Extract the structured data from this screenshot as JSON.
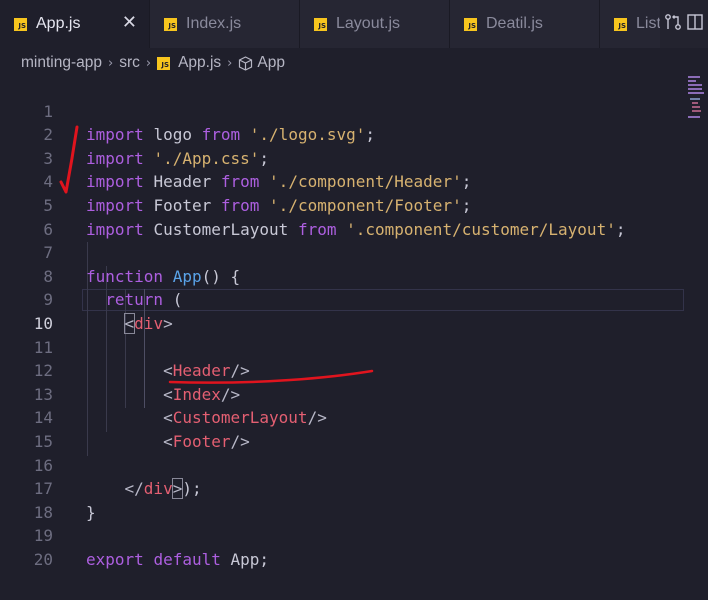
{
  "tabs": [
    {
      "label": "App.js",
      "active": true
    },
    {
      "label": "Index.js",
      "active": false
    },
    {
      "label": "Layout.js",
      "active": false
    },
    {
      "label": "Deatil.js",
      "active": false
    },
    {
      "label": "List",
      "active": false
    }
  ],
  "tab_close_symbol": "✕",
  "breadcrumb": {
    "parts": [
      "minting-app",
      "src",
      "App.js",
      "App"
    ],
    "separator": "›"
  },
  "code_lines": [
    {
      "n": "1"
    },
    {
      "n": "2"
    },
    {
      "n": "3"
    },
    {
      "n": "4"
    },
    {
      "n": "5"
    },
    {
      "n": "6"
    },
    {
      "n": "7"
    },
    {
      "n": "8"
    },
    {
      "n": "9"
    },
    {
      "n": "10"
    },
    {
      "n": "11"
    },
    {
      "n": "12"
    },
    {
      "n": "13"
    },
    {
      "n": "14"
    },
    {
      "n": "15"
    },
    {
      "n": "16"
    },
    {
      "n": "17"
    },
    {
      "n": "18"
    },
    {
      "n": "19"
    },
    {
      "n": "20"
    }
  ],
  "tokens": {
    "import": "import",
    "from": "from",
    "logo": "logo",
    "logo_path": "'./logo.svg'",
    "css_path": "'./App.css'",
    "header": "Header",
    "header_path": "'./component/Header'",
    "footer": "Footer",
    "footer_path": "'./component/Footer'",
    "customer_layout": "CustomerLayout",
    "customer_path": "'.component/customer/Layout'",
    "semicolon": ";",
    "function": "function",
    "app": "App",
    "paren_open_brace": "() {",
    "return": "return",
    "open_paren": "(",
    "lt": "<",
    "gt": ">",
    "div": "div",
    "header_tag": "Header",
    "index_tag": "Index",
    "customer_tag": "CustomerLayout",
    "footer_tag": "Footer",
    "self_close": "/>",
    "close_lt": "</",
    "close_paren_semi": ");",
    "close_brace": "}",
    "export": "export",
    "default": "default",
    "app_semi": "App;"
  },
  "colors": {
    "background": "#1f1f2b",
    "keyword": "#c25ed7",
    "string": "#d7b270",
    "function": "#5aa3e8",
    "tag": "#e45f72",
    "annotation": "#e0141e"
  }
}
